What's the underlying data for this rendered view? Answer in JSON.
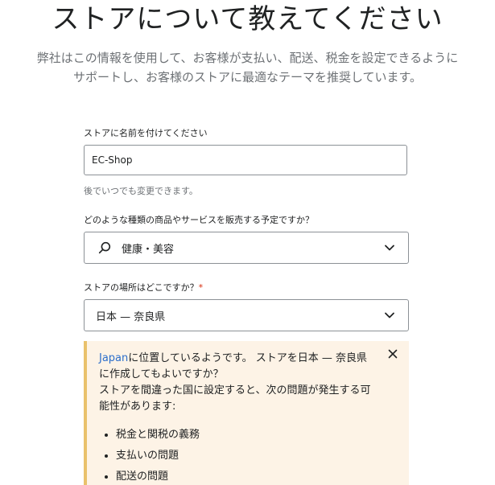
{
  "header": {
    "title": "ストアについて教えてください",
    "subtitle": "弊社はこの情報を使用して、お客様が支払い、配送、税金を設定できるようにサポートし、お客様のストアに最適なテーマを推奨しています。"
  },
  "store_name": {
    "label": "ストアに名前を付けてください",
    "value": "EC-Shop",
    "help": "後でいつでも変更できます。"
  },
  "category": {
    "label": "どのような種類の商品やサービスを販売する予定ですか？",
    "value": "健康・美容"
  },
  "location": {
    "label": "ストアの場所はどこですか？",
    "required_mark": "*",
    "value": "日本 — 奈良県"
  },
  "notice": {
    "link_text": "Japan",
    "message_after_link": "に位置しているようです。 ストアを日本 — 奈良県に作成してもよいですか？",
    "warning": "ストアを間違った国に設定すると、次の問題が発生する可能性があります:",
    "issues": [
      "税金と関税の義務",
      "支払いの問題",
      "配送の問題"
    ]
  },
  "colors": {
    "border": "#8c9196",
    "notice_bg": "#fdf3e6",
    "notice_bar": "#e9c16b",
    "link": "#2c6ecb"
  }
}
